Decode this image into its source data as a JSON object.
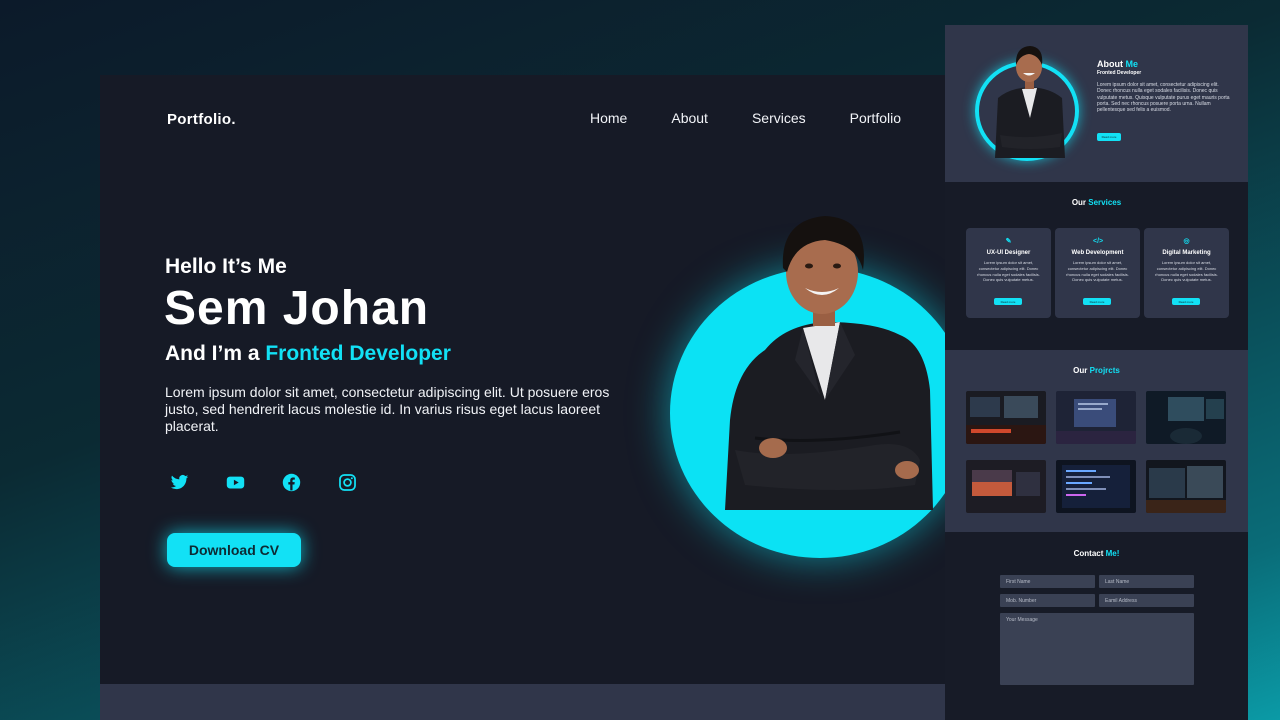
{
  "hero": {
    "logo": "Portfolio.",
    "nav": [
      "Home",
      "About",
      "Services",
      "Portfolio"
    ],
    "greeting": "Hello It’s Me",
    "name": "Sem Johan",
    "role_prefix": "And I’m a ",
    "role_highlight": "Fronted Developer",
    "description": "Lorem ipsum dolor sit amet, consectetur adipiscing elit. Ut posuere eros justo, sed hendrerit lacus molestie id. In varius risus eget lacus laoreet placerat.",
    "socials": [
      "twitter-icon",
      "youtube-icon",
      "facebook-icon",
      "instagram-icon"
    ],
    "cta": "Download CV"
  },
  "about": {
    "title_prefix": "About ",
    "title_highlight": "Me",
    "subtitle": "Fronted Developer",
    "text": "Lorem ipsum dolor sit amet, consectetur adipiscing elit. Donec rhoncus nulla eget sodales facilisis. Donec quis vulputate metus. Quisque vulputate purus eget mauris porta porta. Sed nec rhoncus posuere porta urna. Nullam pellentesque sed felis a euismod.",
    "button": "Read more"
  },
  "services": {
    "title_prefix": "Our ",
    "title_highlight": "Services",
    "cards": [
      {
        "icon": "✎",
        "name": "UX-UI Designer",
        "text": "Lorem ipsum dolor sit amet, consectetur adipiscing elit. Donec rhoncus nulla eget sodales facilisis. Donec quis vulputate metus.",
        "button": "Read more"
      },
      {
        "icon": "</>",
        "name": "Web Development",
        "text": "Lorem ipsum dolor sit amet, consectetur adipiscing elit. Donec rhoncus nulla eget sodales facilisis. Donec quis vulputate metus.",
        "button": "Read more"
      },
      {
        "icon": "◎",
        "name": "Digital Marketing",
        "text": "Lorem ipsum dolor sit amet, consectetur adipiscing elit. Donec rhoncus nulla eget sodales facilisis. Donec quis vulputate metus.",
        "button": "Read more"
      }
    ]
  },
  "projects": {
    "title_prefix": "Our ",
    "title_highlight": "Projrcts"
  },
  "contact": {
    "title_prefix": "Contact ",
    "title_highlight": "Me!",
    "first_name": "First Name",
    "last_name": "Last Name",
    "mob": "Mob. Number",
    "email": "Eamil Address",
    "message": "Your Message"
  },
  "colors": {
    "accent": "#12e1f5",
    "background": "#161a26",
    "panel": "#30364a"
  }
}
